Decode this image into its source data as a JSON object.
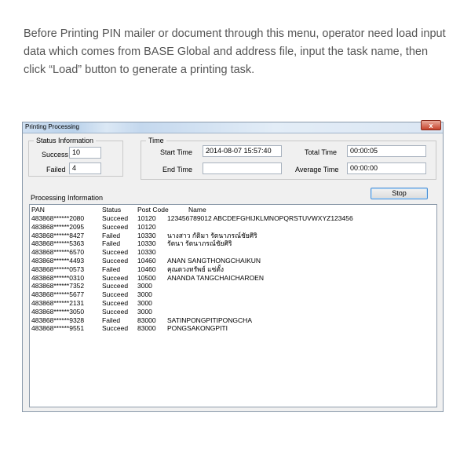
{
  "intro_text": "Before Printing PIN mailer or document through this menu, operator need load input data which comes from BASE Global and address file, input the task name, then click “Load” button to generate a printing task.",
  "window": {
    "title": "Printing Processing",
    "close_label": "x"
  },
  "status_info": {
    "label": "Status Information",
    "success_label": "Success",
    "success_value": "10",
    "failed_label": "Failed",
    "failed_value": "4"
  },
  "time": {
    "label": "Time",
    "start_time_label": "Start Time",
    "start_time_value": "2014-08-07 15:57:40",
    "end_time_label": "End Time",
    "end_time_value": "",
    "total_time_label": "Total Time",
    "total_time_value": "00:00:05",
    "average_time_label": "Average Time",
    "average_time_value": "00:00:00"
  },
  "stop_button_label": "Stop",
  "processing_info": {
    "label": "Processing Information",
    "headers": {
      "pan": "PAN",
      "status": "Status",
      "post_code": "Post Code",
      "name": "Name"
    },
    "rows": [
      {
        "pan": "483868******2080",
        "status": "Succeed",
        "post_code": "10120",
        "name": "123456789012 ABCDEFGHIJKLMNOPQRSTUVWXYZ123456"
      },
      {
        "pan": "483868******2095",
        "status": "Succeed",
        "post_code": "10120",
        "name": ""
      },
      {
        "pan": "483868******8427",
        "status": "Failed",
        "post_code": "10330",
        "name": "นางสาว กัติมา รัตนาภรณ์ชัยศิริ"
      },
      {
        "pan": "483868******5363",
        "status": "Failed",
        "post_code": "10330",
        "name": "รัตนา รัตนาภรณ์ชัยศิริ"
      },
      {
        "pan": "483868******6570",
        "status": "Succeed",
        "post_code": "10330",
        "name": ""
      },
      {
        "pan": "483868******4493",
        "status": "Succeed",
        "post_code": "10460",
        "name": "ANAN SANGTHONGCHAIKUN"
      },
      {
        "pan": "483868******0573",
        "status": "Failed",
        "post_code": "10460",
        "name": "คุณดวงทรัพย์ แซ่ตั้ง"
      },
      {
        "pan": "483868******0310",
        "status": "Succeed",
        "post_code": "10500",
        "name": "ANANDA TANGCHAICHAROEN"
      },
      {
        "pan": "483868******7352",
        "status": "Succeed",
        "post_code": "3000",
        "name": ""
      },
      {
        "pan": "483868******5677",
        "status": "Succeed",
        "post_code": "3000",
        "name": ""
      },
      {
        "pan": "483868******2131",
        "status": "Succeed",
        "post_code": "3000",
        "name": ""
      },
      {
        "pan": "483868******3050",
        "status": "Succeed",
        "post_code": "3000",
        "name": ""
      },
      {
        "pan": "483868******9328",
        "status": "Failed",
        "post_code": "83000",
        "name": "SATINPONGPITIPONGCHA"
      },
      {
        "pan": "483868******9551",
        "status": "Succeed",
        "post_code": "83000",
        "name": "PONGSAKONGPITI"
      }
    ]
  }
}
